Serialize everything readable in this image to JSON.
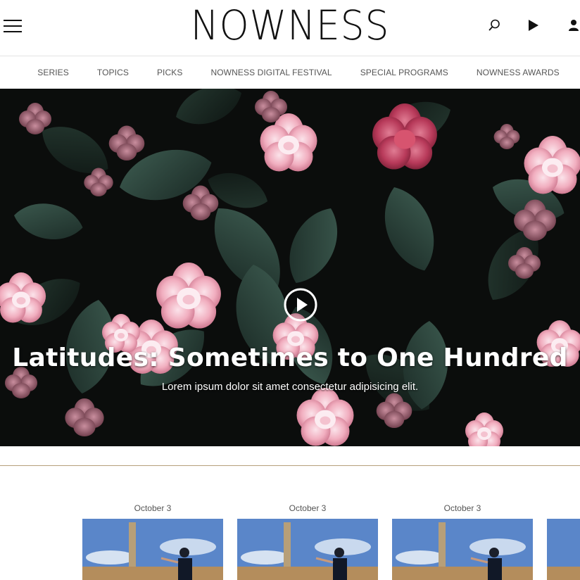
{
  "header": {
    "logo": "NOWNESS",
    "icons": [
      "menu-icon",
      "search-icon",
      "play-icon",
      "user-icon"
    ]
  },
  "nav": {
    "items": [
      {
        "label": "SERIES"
      },
      {
        "label": "TOPICS"
      },
      {
        "label": "PICKS"
      },
      {
        "label": "NOWNESS DIGITAL FESTIVAL"
      },
      {
        "label": "SPECIAL PROGRAMS"
      },
      {
        "label": "NOWNESS AWARDS"
      }
    ]
  },
  "hero": {
    "title": "Latitudes: Sometimes to One Hundred",
    "subtitle": "Lorem ipsum dolor sit amet consectetur adipisicing elit."
  },
  "cards": [
    {
      "date": "October 3"
    },
    {
      "date": "October 3"
    },
    {
      "date": "October 3"
    },
    {
      "date": ""
    }
  ],
  "colors": {
    "divider": "#b59f7a",
    "nav_text": "#555555",
    "hero_bg": "#0b0d0c"
  }
}
